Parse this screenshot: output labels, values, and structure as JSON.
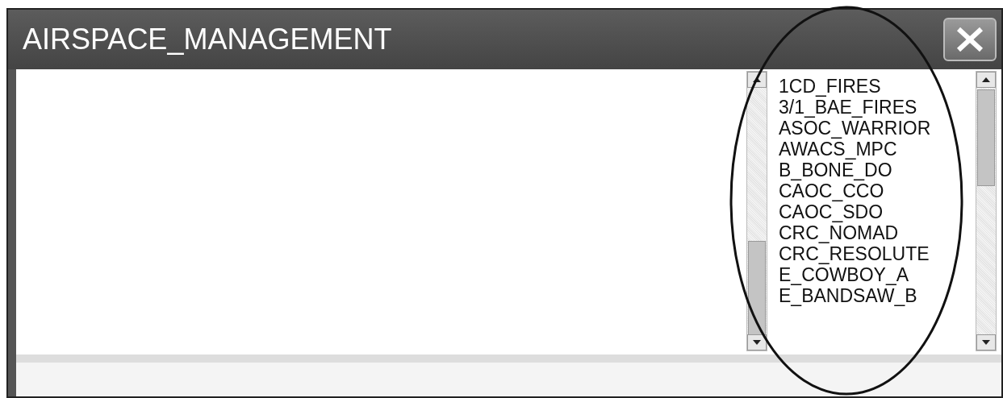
{
  "window": {
    "title": "AIRSPACE_MANAGEMENT"
  },
  "list": {
    "items": [
      "1CD_FIRES",
      "3/1_BAE_FIRES",
      "ASOC_WARRIOR",
      "AWACS_MPC",
      "B_BONE_DO",
      "CAOC_CCO",
      "CAOC_SDO",
      "CRC_NOMAD",
      "CRC_RESOLUTE",
      "E_COWBOY_A",
      "E_BANDSAW_B"
    ]
  }
}
